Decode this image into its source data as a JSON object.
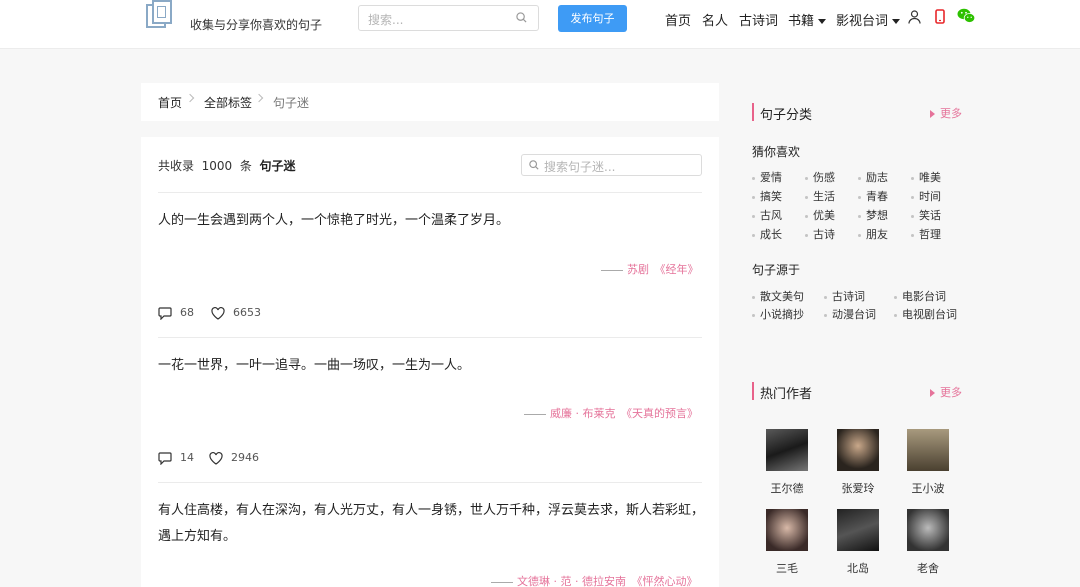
{
  "header": {
    "site_slogan": "收集与分享你喜欢的句子",
    "search_placeholder": "搜索...",
    "publish_label": "发布句子",
    "nav": [
      "首页",
      "名人",
      "古诗词",
      "书籍",
      "影视台词"
    ]
  },
  "breadcrumb": [
    "首页",
    "全部标签",
    "句子迷"
  ],
  "list_header": {
    "prefix": "共收录",
    "count": "1000",
    "unit": "条",
    "tag": "句子迷",
    "search_placeholder": "搜索句子迷..."
  },
  "quotes": [
    {
      "text": "人的一生会遇到两个人，一个惊艳了时光，一个温柔了岁月。",
      "source": "苏剧　《经年》",
      "comments": "68",
      "likes": "6653"
    },
    {
      "text": "一花一世界，一叶一追寻。一曲一场叹，一生为一人。",
      "source": "威廉 · 布莱克　《天真的预言》",
      "comments": "14",
      "likes": "2946"
    },
    {
      "text": "有人住高楼，有人在深沟，有人光万丈，有人一身锈，世人万千种，浮云莫去求，斯人若彩虹，遇上方知有。",
      "source": "文德琳 · 范 · 德拉安南　《怦然心动》"
    }
  ],
  "sidebar": {
    "categories_title": "句子分类",
    "more_label": "更多",
    "guess_title": "猜你喜欢",
    "guess_tags": [
      "爱情",
      "伤感",
      "励志",
      "唯美",
      "搞笑",
      "生活",
      "青春",
      "时间",
      "古风",
      "优美",
      "梦想",
      "笑话",
      "成长",
      "古诗",
      "朋友",
      "哲理"
    ],
    "source_title": "句子源于",
    "source_tags": [
      "散文美句",
      "古诗词",
      "电影台词",
      "小说摘抄",
      "动漫台词",
      "电视剧台词"
    ],
    "authors_title": "热门作者",
    "authors": [
      "王尔德",
      "张爱玲",
      "王小波",
      "三毛",
      "北岛",
      "老舍"
    ]
  },
  "colors": {
    "accent_pink": "#e5739a",
    "primary_blue": "#3e9bf5",
    "phone_red": "#e8262a",
    "wechat_green": "#2dc100"
  },
  "icons": [
    "logo-icon",
    "search-icon",
    "user-icon",
    "phone-icon",
    "wechat-icon",
    "comment-icon",
    "heart-icon"
  ]
}
